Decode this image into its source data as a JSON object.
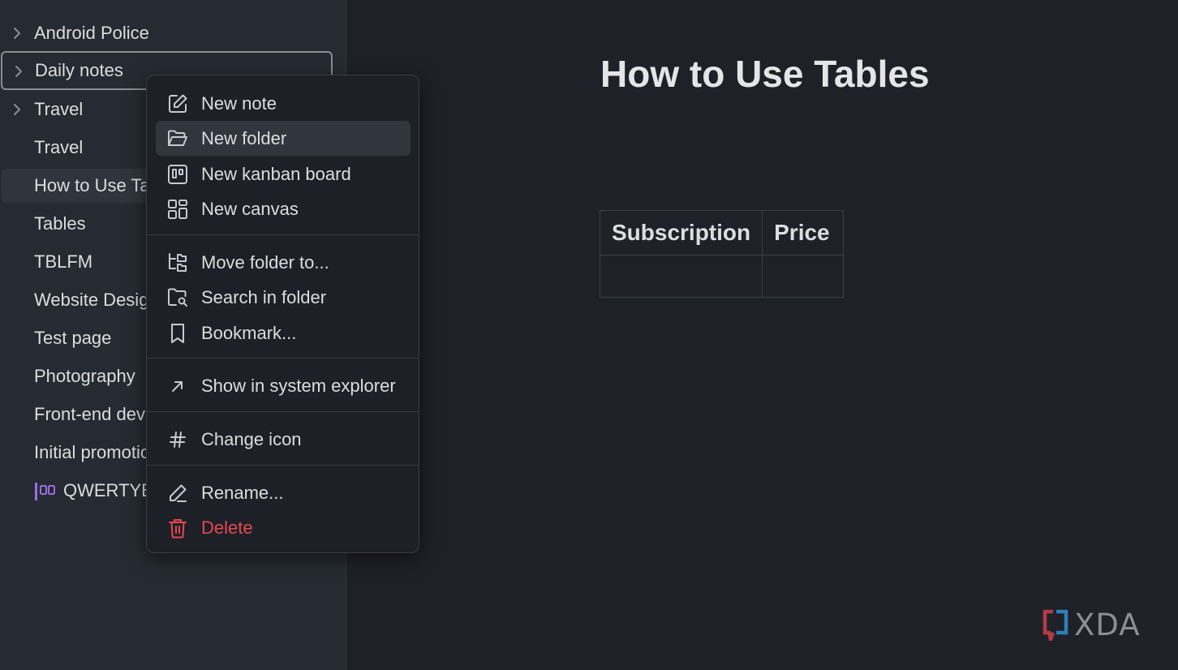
{
  "sidebar": {
    "items": [
      {
        "label": "Android Police",
        "chevron": true
      },
      {
        "label": "Daily notes",
        "chevron": true
      },
      {
        "label": "Travel",
        "chevron": true
      },
      {
        "label": "Travel",
        "chevron": false
      },
      {
        "label": "How to Use Tables",
        "chevron": false
      },
      {
        "label": "Tables",
        "chevron": false
      },
      {
        "label": "TBLFM",
        "chevron": false
      },
      {
        "label": "Website Design",
        "chevron": false
      },
      {
        "label": "Test page",
        "chevron": false
      },
      {
        "label": "Photography",
        "chevron": false
      },
      {
        "label": "Front-end dev",
        "chevron": false
      },
      {
        "label": "Initial promotion",
        "chevron": false
      },
      {
        "label": "QWERTYBT",
        "chevron": false,
        "icon": "kanban-icon"
      }
    ]
  },
  "document": {
    "title": "How to Use Tables",
    "table": {
      "headers": [
        "Subscription",
        "Price"
      ],
      "rows": [
        [
          "",
          ""
        ]
      ]
    }
  },
  "context_menu": {
    "items": [
      {
        "label": "New note",
        "icon": "edit-note-icon"
      },
      {
        "label": "New folder",
        "icon": "folder-open-icon",
        "hovered": true
      },
      {
        "label": "New kanban board",
        "icon": "kanban-board-icon"
      },
      {
        "label": "New canvas",
        "icon": "canvas-icon"
      },
      {
        "label": "Move folder to...",
        "icon": "move-folder-icon"
      },
      {
        "label": "Search in folder",
        "icon": "folder-search-icon"
      },
      {
        "label": "Bookmark...",
        "icon": "bookmark-icon"
      },
      {
        "label": "Show in system explorer",
        "icon": "arrow-up-right-icon"
      },
      {
        "label": "Change icon",
        "icon": "hash-icon"
      },
      {
        "label": "Rename...",
        "icon": "pencil-icon"
      },
      {
        "label": "Delete",
        "icon": "trash-icon",
        "danger": true
      }
    ]
  },
  "watermark": {
    "text": "XDA"
  },
  "colors": {
    "background": "#1e2128",
    "sidebar": "#262a32",
    "menu": "#1d2027",
    "text": "#dcddde",
    "danger": "#e5484d",
    "kanban_accent": "#9a6ee0",
    "watermark_red": "#b53a48",
    "watermark_blue": "#2f7fb8"
  }
}
